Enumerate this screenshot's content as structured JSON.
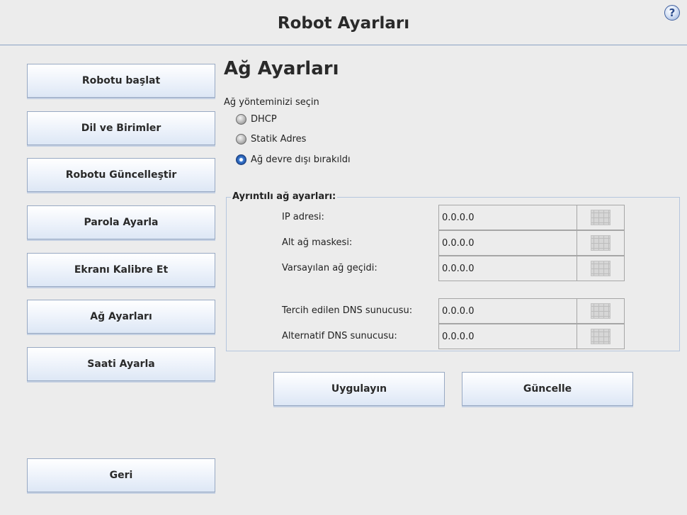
{
  "header": {
    "title": "Robot Ayarları",
    "help_label": "?"
  },
  "sidebar": {
    "items": [
      {
        "label": "Robotu başlat"
      },
      {
        "label": "Dil ve Birimler"
      },
      {
        "label": "Robotu Güncelleştir"
      },
      {
        "label": "Parola Ayarla"
      },
      {
        "label": "Ekranı Kalibre Et"
      },
      {
        "label": "Ağ Ayarları"
      },
      {
        "label": "Saati Ayarla"
      }
    ],
    "back_label": "Geri"
  },
  "main": {
    "title": "Ağ Ayarları",
    "method_prompt": "Ağ yönteminizi seçin",
    "methods": [
      {
        "label": "DHCP",
        "selected": false
      },
      {
        "label": "Statik Adres",
        "selected": false
      },
      {
        "label": "Ağ devre dışı bırakıldı",
        "selected": true
      }
    ],
    "details_title": "Ayrıntılı ağ ayarları:",
    "fields": [
      {
        "label": "IP adresi:",
        "value": "0.0.0.0"
      },
      {
        "label": "Alt ağ maskesi:",
        "value": "0.0.0.0"
      },
      {
        "label": "Varsayılan ağ geçidi:",
        "value": "0.0.0.0"
      },
      {
        "label": "Tercih edilen DNS sunucusu:",
        "value": "0.0.0.0"
      },
      {
        "label": "Alternatif DNS sunucusu:",
        "value": "0.0.0.0"
      }
    ],
    "apply_label": "Uygulayın",
    "refresh_label": "Güncelle"
  }
}
